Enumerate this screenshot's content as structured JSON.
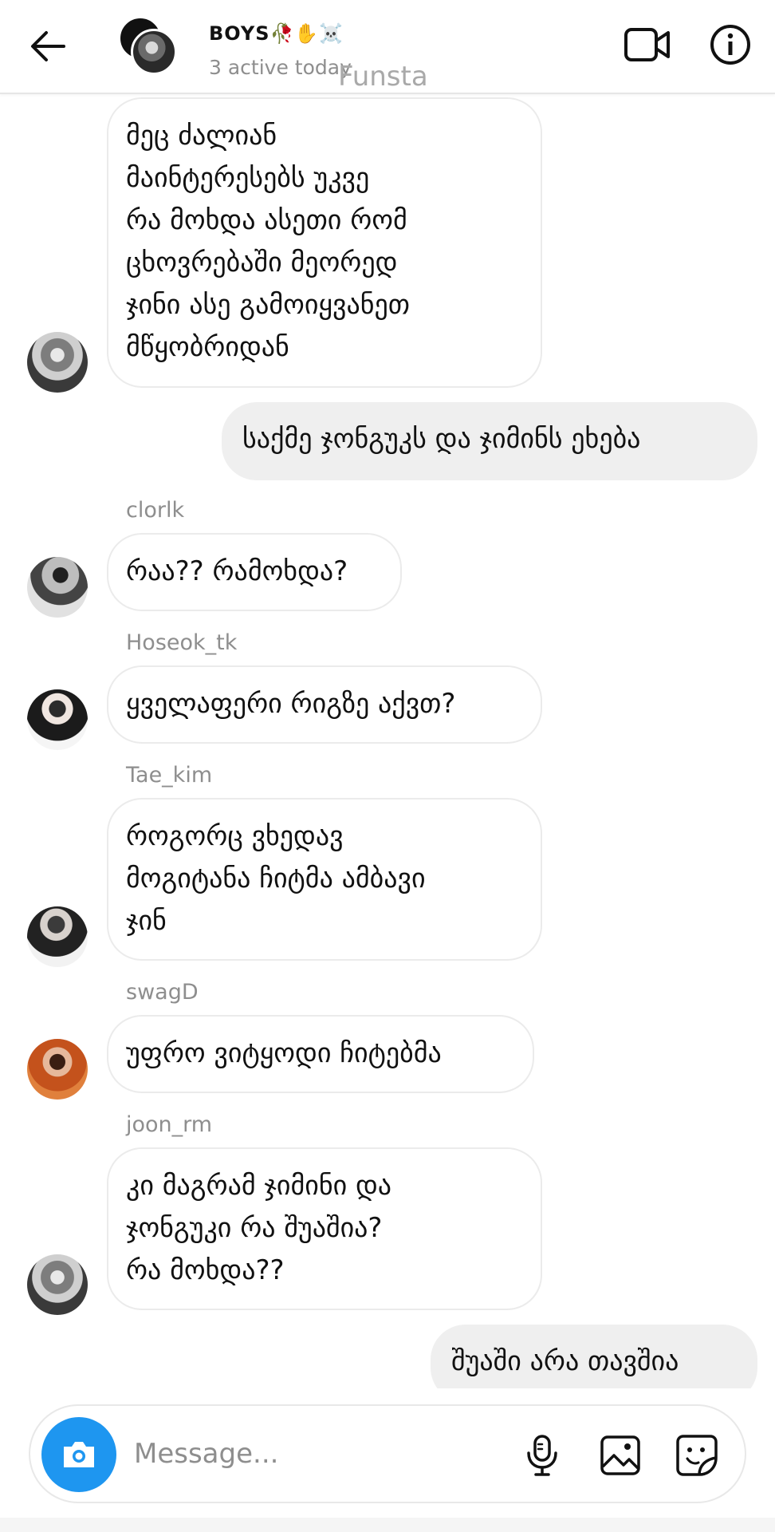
{
  "header": {
    "title": "BOYS🥀✋☠️",
    "status": "3 active today",
    "watermark": "Funsta"
  },
  "messages": [
    {
      "id": 1,
      "direction": "incoming",
      "sender": "",
      "avatar": "grey",
      "text": "მეც ძალიან\nმაინტერესებს უკვე\nრა მოხდა ასეთი რომ\nცხოვრებაში მეორედ\nჯინი ასე გამოიყვანეთ\nმწყობრიდან"
    },
    {
      "id": 2,
      "direction": "outgoing",
      "text": "საქმე ჯონგუკს და ჯიმინს ეხება"
    },
    {
      "id": 3,
      "direction": "incoming",
      "sender": "clorlk",
      "avatar": "guitar",
      "text": "რაა?? რამოხდა?"
    },
    {
      "id": 4,
      "direction": "incoming",
      "sender": "Hoseok_tk",
      "avatar": "suit",
      "text": "ყველაფერი რიგზე აქვთ?"
    },
    {
      "id": 5,
      "direction": "incoming",
      "sender": "Tae_kim",
      "avatar": "dark",
      "text": "როგორც ვხედავ\nმოგიტანა ჩიტმა ამბავი\nჯინ"
    },
    {
      "id": 6,
      "direction": "incoming",
      "sender": "swagD",
      "avatar": "orange",
      "text": "უფრო ვიტყოდი ჩიტებმა"
    },
    {
      "id": 7,
      "direction": "incoming",
      "sender": "joon_rm",
      "avatar": "grey",
      "text": "კი მაგრამ ჯიმინი და\nჯონგუკი რა შუაშია?\nრა მოხდა??"
    },
    {
      "id": 8,
      "direction": "outgoing",
      "text": "შუაში არა თავშია"
    }
  ],
  "composer": {
    "placeholder": "Message..."
  },
  "icons": {
    "back": "arrow-left-icon",
    "video": "video-camera-icon",
    "info": "info-icon",
    "camera": "camera-icon",
    "mic": "microphone-icon",
    "gallery": "image-icon",
    "sticker": "sticker-icon"
  },
  "colors": {
    "accent": "#1e96f0",
    "outgoing_bubble": "#efefef",
    "muted_text": "#8e8e8e"
  }
}
